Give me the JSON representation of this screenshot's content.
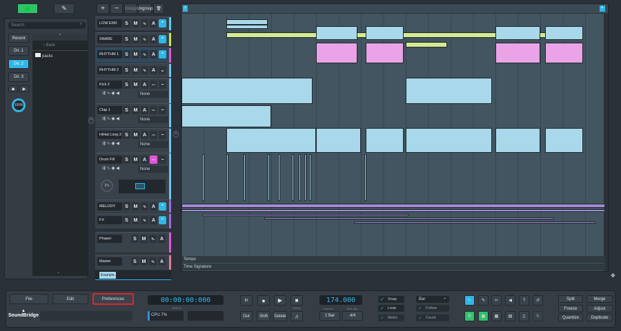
{
  "top": {
    "browser_icon": "browser-panel-icon",
    "plugin_icon": "plug-icon"
  },
  "browser": {
    "search_placeholder": "Search",
    "tabs": [
      "Recent",
      "Dir. 1",
      "Dir. 2",
      "Dir. 3"
    ],
    "active_tab": "Dir. 2",
    "back": "‹ Back",
    "folders": [
      "packs"
    ],
    "volume": "100%"
  },
  "track_toolbar": {
    "add": "+",
    "remove": "−",
    "group": "Group",
    "ungroup": "Ungroup"
  },
  "tracks": [
    {
      "name": "LOW END",
      "color": "#4fd0f0"
    },
    {
      "name": "SNARE",
      "color": "#c9e84a"
    },
    {
      "name": "RHYTHM 1",
      "color": "#e455d8"
    },
    {
      "name": "RHYTHM 2",
      "color": "#6dc7ee"
    },
    {
      "name": "Kick 2",
      "color": "#6dc7ee",
      "device": "None"
    },
    {
      "name": "Clap 1",
      "color": "#6dc7ee",
      "device": "None"
    },
    {
      "name": "HiHat Loop 2",
      "color": "#6dc7ee",
      "device": "None"
    },
    {
      "name": "Drum Fill",
      "color": "#6dc7ee",
      "device": "None"
    },
    {
      "name": "MELODY",
      "color": "#9f6be0"
    },
    {
      "name": "FX",
      "color": "#9f6be0"
    },
    {
      "name": "Phaser",
      "color": "#e455d8"
    },
    {
      "name": "Master",
      "color": "#e67c8c"
    }
  ],
  "drumfill_knob": "2½",
  "buttons": {
    "s": "S",
    "m": "M",
    "a": "A"
  },
  "scene": "Example...",
  "arranger": {
    "tempo_label": "Tempo",
    "timesig_label": "Time Signature",
    "marker": "1"
  },
  "bottom": {
    "file": "File",
    "edit": "Edit",
    "preferences": "Preferences",
    "logo": "SoundBridge",
    "time": "00:00:00:000",
    "midi_in": "MIDI In",
    "cpu": "CPU 7%",
    "in": "In",
    "out": "Out",
    "shift": "Shift",
    "delete": "Delete",
    "swing": "Swing",
    "tempo": "174.000",
    "count_in_label": "Count In",
    "count_in": "2 Bar",
    "time_sig_label": "Time Sig.",
    "time_sig": "4/4",
    "snap": "Snap",
    "loop": "Loop",
    "metro": "Metro",
    "grid": "Bar",
    "follow": "Follow",
    "count": "Count",
    "split": "Split",
    "merge": "Merge",
    "freeze": "Freeze",
    "adjust": "Adjust",
    "quantize": "Quantize",
    "duplicate": "Duplicate"
  },
  "colors": {
    "accent": "#2fb7e6",
    "green": "#2fc26a",
    "highlight_box": "#e0262b"
  }
}
